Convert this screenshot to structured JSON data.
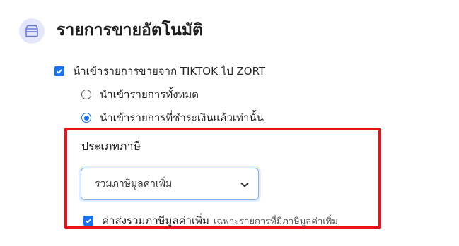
{
  "section": {
    "title": "รายการขายอัตโนมัติ",
    "icon": "store-icon",
    "accent_color": "#1a73e8"
  },
  "import_option": {
    "label": "นำเข้ารายการขายจาก TIKTOK ไป ZORT",
    "checked": true
  },
  "radio_options": [
    {
      "label": "นำเข้ารายการทั้งหมด",
      "selected": false
    },
    {
      "label": "นำเข้ารายการที่ชำระเงินแล้วเท่านั้น",
      "selected": true
    }
  ],
  "tax": {
    "label": "ประเภทภาษี",
    "selected_value": "รวมภาษีมูลค่าเพิ่ม",
    "shipping_vat_label": "ค่าส่งรวมภาษีมูลค่าเพิ่ม",
    "shipping_vat_note": "เฉพาะรายการที่มีภาษีมูลค่าเพิ่ม",
    "shipping_vat_checked": true
  },
  "highlight_color": "#e8131a"
}
